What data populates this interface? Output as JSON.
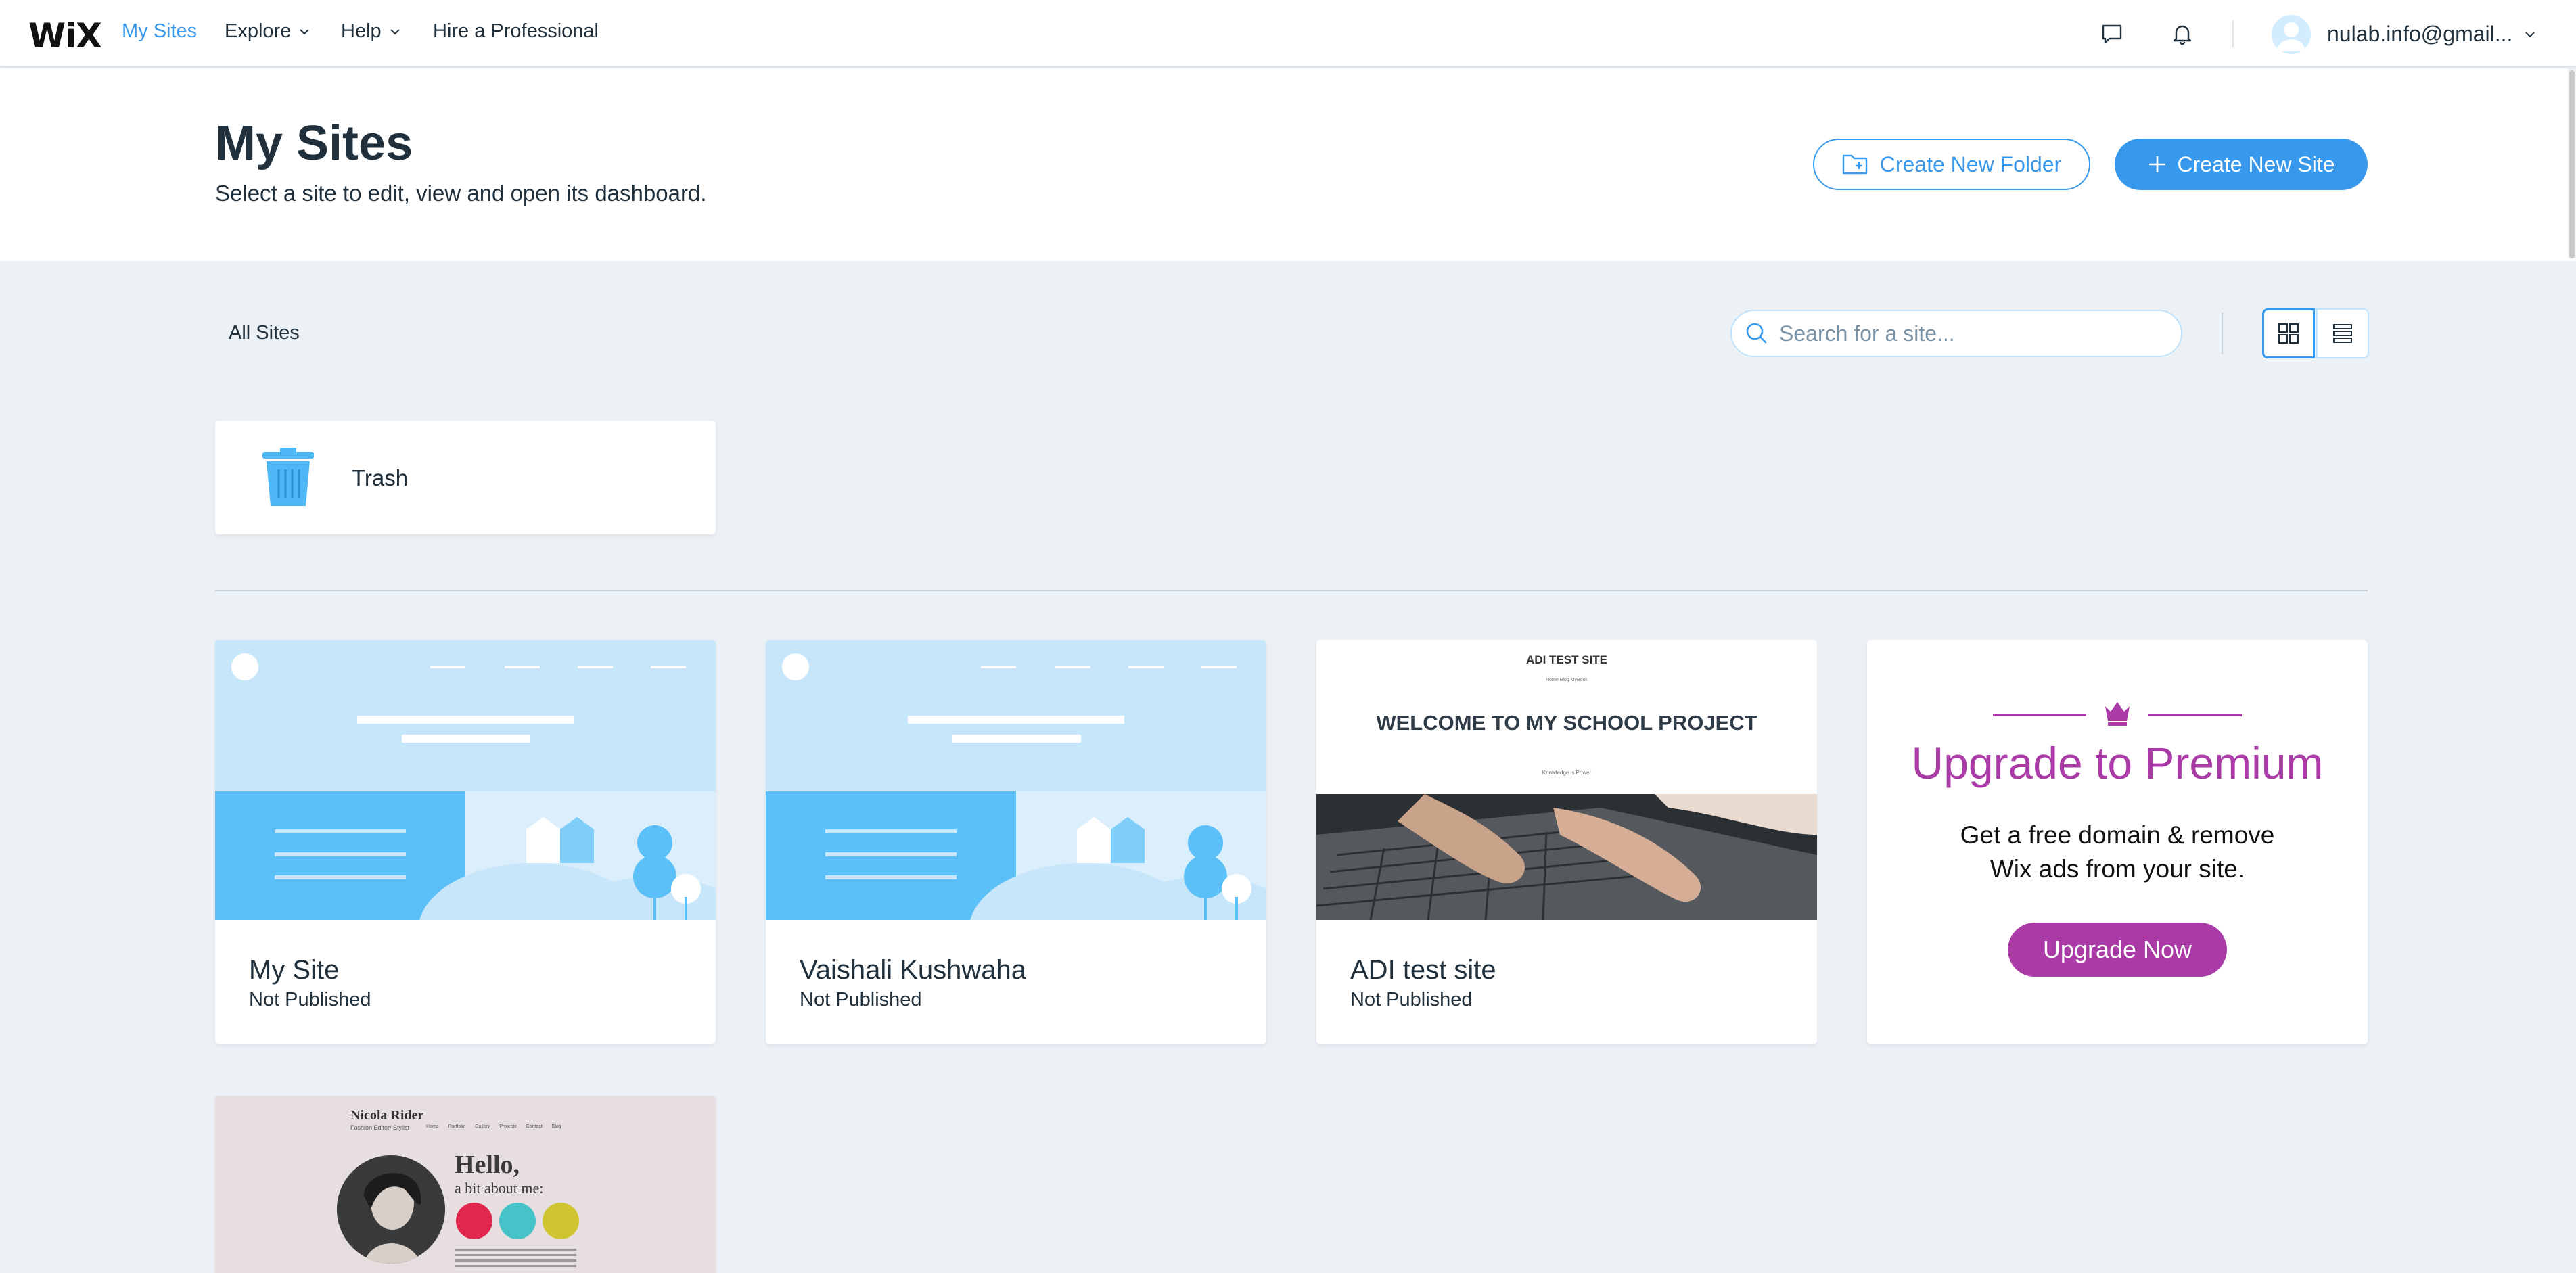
{
  "topbar": {
    "logo": "WiX",
    "nav": [
      {
        "label": "My Sites",
        "active": true
      },
      {
        "label": "Explore",
        "dropdown": true
      },
      {
        "label": "Help",
        "dropdown": true
      },
      {
        "label": "Hire a Professional"
      }
    ],
    "icons": [
      "chat-icon",
      "bell-icon"
    ],
    "account": "nulab.info@gmail..."
  },
  "header": {
    "title": "My Sites",
    "subtitle": "Select a site to edit, view and open its dashboard.",
    "create_folder_label": "Create New Folder",
    "create_site_label": "Create New Site"
  },
  "toolbar": {
    "breadcrumb": "All Sites",
    "search_placeholder": "Search for a site...",
    "view_mode": "grid"
  },
  "trash": {
    "label": "Trash"
  },
  "sites": [
    {
      "name": "My Site",
      "status": "Not Published",
      "thumbnail": "placeholder-illustration"
    },
    {
      "name": "Vaishali Kushwaha",
      "status": "Not Published",
      "thumbnail": "placeholder-illustration"
    },
    {
      "name": "ADI test site",
      "status": "Not Published",
      "thumbnail": "school-project"
    }
  ],
  "adi_thumb": {
    "site_title": "ADI TEST SITE",
    "nav": "Home   Blog   MyBook",
    "welcome": "WELCOME TO MY SCHOOL PROJECT",
    "tagline": "Knowledge is Power"
  },
  "upgrade": {
    "title": "Upgrade to Premium",
    "description_line1": "Get a free domain & remove",
    "description_line2": "Wix ads from your site.",
    "button_label": "Upgrade Now"
  },
  "nicola_thumb": {
    "name": "Nicola Rider",
    "subtitle": "Fashion Editor/ Stylist",
    "nav": "Home Portfolio Gallery Projects Contact Blog",
    "hello": "Hello,",
    "about": "a bit about me:"
  },
  "colors": {
    "accent": "#3899ec",
    "premium": "#aa3ba6",
    "background": "#ecf1f6",
    "text": "#20303c"
  }
}
